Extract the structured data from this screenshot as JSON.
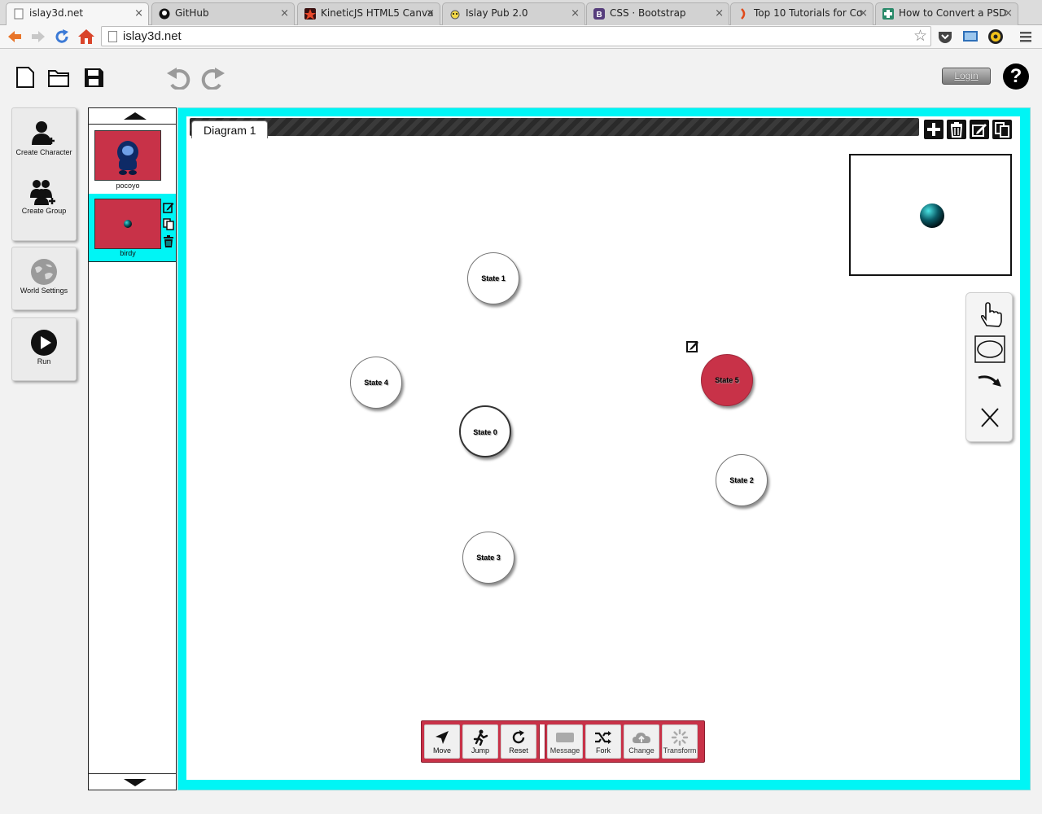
{
  "browser": {
    "tabs": [
      {
        "title": "islay3d.net",
        "favicon": "page-icon",
        "active": true
      },
      {
        "title": "GitHub",
        "favicon": "github-icon",
        "active": false
      },
      {
        "title": "KineticJS HTML5 Canva",
        "favicon": "kinetic-icon",
        "active": false
      },
      {
        "title": "Islay Pub 2.0",
        "favicon": "islay-icon",
        "active": false
      },
      {
        "title": "CSS · Bootstrap",
        "favicon": "bootstrap-icon",
        "active": false
      },
      {
        "title": "Top 10 Tutorials for Co",
        "favicon": "tutorial-icon",
        "active": false
      },
      {
        "title": "How to Convert a PSD",
        "favicon": "psd-icon",
        "active": false
      }
    ],
    "tab_close": "×",
    "url": "islay3d.net",
    "colors": {
      "back_arrow": "#e8752a",
      "reload": "#3c7ad6",
      "home": "#d9442a"
    }
  },
  "app": {
    "toolbar": {
      "icons": [
        "new-file-icon",
        "open-folder-icon",
        "save-icon",
        "undo-icon",
        "redo-icon"
      ],
      "login_label": "Login",
      "help_label": "?"
    },
    "sidebar": {
      "create_character": "Create Character",
      "create_group": "Create Group",
      "world_settings": "World Settings",
      "run": "Run"
    },
    "sprites": [
      {
        "name": "pocoyo",
        "selected": false
      },
      {
        "name": "birdy",
        "selected": true
      }
    ],
    "workspace": {
      "tab_title": "Diagram 1",
      "tab_actions": [
        "add-diagram-icon",
        "delete-diagram-icon",
        "rename-diagram-icon",
        "copy-diagram-icon"
      ],
      "states": [
        {
          "label": "State 0",
          "initial": true,
          "selected": false
        },
        {
          "label": "State 1",
          "initial": false,
          "selected": false
        },
        {
          "label": "State 2",
          "initial": false,
          "selected": false
        },
        {
          "label": "State 3",
          "initial": false,
          "selected": false
        },
        {
          "label": "State 4",
          "initial": false,
          "selected": false
        },
        {
          "label": "State 5",
          "initial": false,
          "selected": true
        }
      ],
      "tools": [
        "hand-pointer-icon",
        "ellipse-icon",
        "transition-arrow-icon",
        "close-x-icon"
      ],
      "actions": [
        {
          "label": "Move",
          "icon": "navigation-arrow-icon"
        },
        {
          "label": "Jump",
          "icon": "jumping-figure-icon"
        },
        {
          "label": "Reset",
          "icon": "refresh-icon"
        },
        {
          "label": "Message",
          "icon": "message-icon"
        },
        {
          "label": "Fork",
          "icon": "shuffle-icon"
        },
        {
          "label": "Change",
          "icon": "cloud-upload-icon"
        },
        {
          "label": "Transform",
          "icon": "spinner-icon"
        }
      ]
    },
    "colors": {
      "frame": "#00f5f5",
      "accent": "#c83248",
      "workspace": "#ffffff"
    }
  }
}
